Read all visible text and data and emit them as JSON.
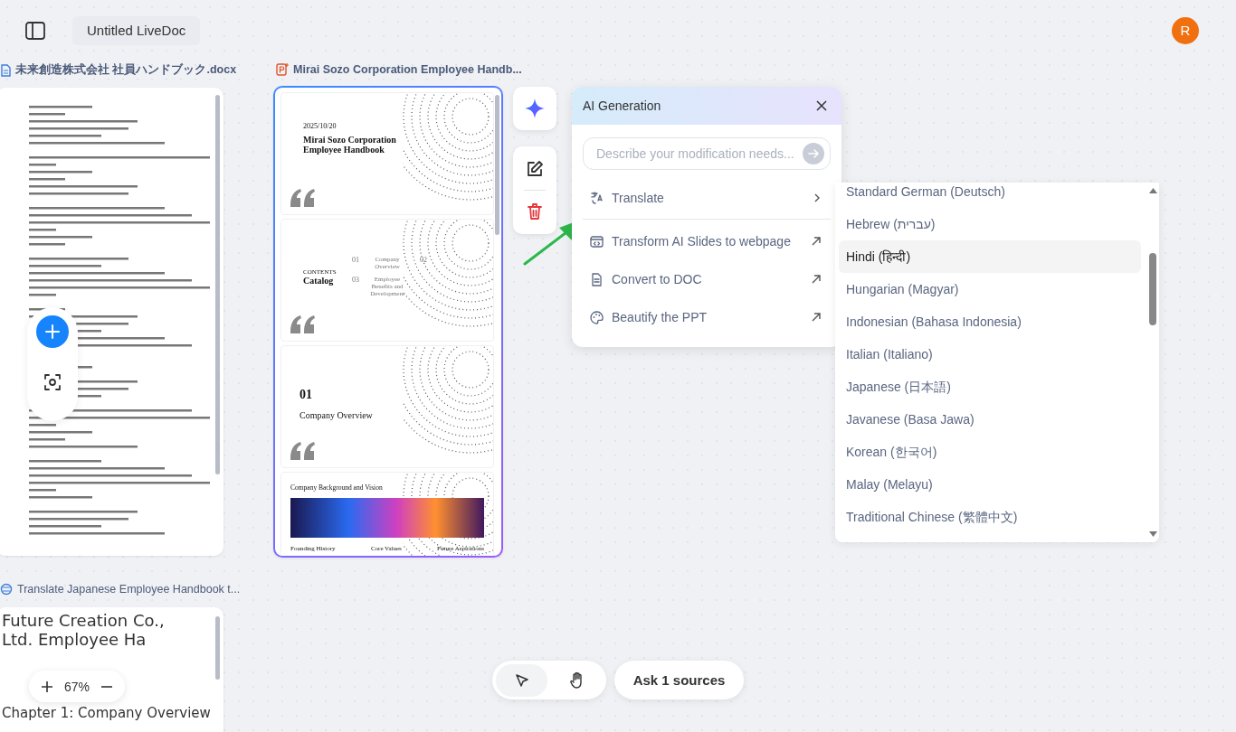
{
  "header": {
    "title": "Untitled LiveDoc",
    "avatar": "R"
  },
  "cards": [
    {
      "kind": "docx",
      "title": "未来創造株式会社 社員ハンドブック.docx",
      "selected": false
    },
    {
      "kind": "slides",
      "title": "Mirai Sozo Corporation Employee Handb...",
      "selected": true,
      "slides": [
        {
          "kind": "cover",
          "date": "2025/10/20",
          "title": "Mirai Sozo Corporation Employee Handbook"
        },
        {
          "kind": "contents",
          "eyebrow": "CONTENTS",
          "title": "Catalog",
          "entries": [
            {
              "number": "01",
              "label": "Company Overview"
            },
            {
              "number": "02"
            },
            {
              "number": "03",
              "label": "Employee Benefits and Development"
            }
          ]
        },
        {
          "kind": "section",
          "number": "01",
          "title": "Company Overview"
        },
        {
          "kind": "content",
          "title": "Company Background and Vision",
          "captions": [
            "Founding History",
            "Core Values",
            "Future Aspirations"
          ]
        }
      ]
    },
    {
      "kind": "doc",
      "title": "Translate Japanese Employee Handbook t...",
      "selected": false,
      "heading": "Future Creation Co., Ltd. Employee Ha",
      "subheading": "Chapter 1: Company Overview"
    }
  ],
  "zoom": {
    "value": "67%"
  },
  "ai_panel": {
    "title": "AI Generation",
    "placeholder": "Describe your modification needs...",
    "items": [
      {
        "kind": "submenu",
        "label": "Translate"
      },
      {
        "kind": "external",
        "label": "Transform AI Slides to webpage"
      },
      {
        "kind": "external",
        "label": "Convert to DOC"
      },
      {
        "kind": "external",
        "label": "Beautify the PPT"
      }
    ]
  },
  "languages": [
    {
      "label": "Standard German (Deutsch)",
      "selected": false
    },
    {
      "label": "Hebrew (עברית)",
      "selected": false
    },
    {
      "label": "Hindi (हिन्दी)",
      "selected": true
    },
    {
      "label": "Hungarian (Magyar)",
      "selected": false
    },
    {
      "label": "Indonesian (Bahasa Indonesia)",
      "selected": false
    },
    {
      "label": "Italian (Italiano)",
      "selected": false
    },
    {
      "label": "Japanese (日本語)",
      "selected": false
    },
    {
      "label": "Javanese (Basa Jawa)",
      "selected": false
    },
    {
      "label": "Korean (한국어)",
      "selected": false
    },
    {
      "label": "Malay (Melayu)",
      "selected": false
    },
    {
      "label": "Traditional Chinese (繁體中文)",
      "selected": false
    }
  ],
  "tools": [
    {
      "kind": "pointer",
      "selected": true
    },
    {
      "kind": "hand",
      "selected": false
    }
  ],
  "ask_button": "Ask 1 sources"
}
